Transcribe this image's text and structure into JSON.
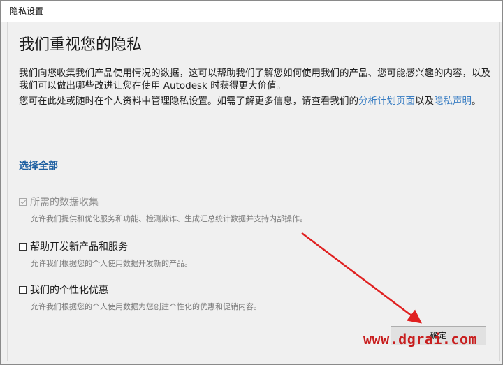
{
  "window": {
    "title": "隐私设置"
  },
  "main": {
    "heading": "我们重视您的隐私",
    "para1": "我们向您收集我们产品使用情况的数据，这可以帮助我们了解您如何使用我们的产品、您可能感兴趣的内容，以及我们可以做出哪些改进让您在使用 Autodesk 时获得更大价值。",
    "para2_prefix": "您可在此处或随时在个人资料中管理隐私设置。如需了解更多信息，请查看我们的",
    "link_analytics": "分析计划页面",
    "para2_mid": "以及",
    "link_privacy": "隐私声明",
    "para2_suffix": "。",
    "select_all": "选择全部",
    "options": [
      {
        "label": "所需的数据收集",
        "desc": "允许我们提供和优化服务和功能、检测欺诈、生成汇总统计数据并支持内部操作。",
        "checked": true,
        "disabled": true
      },
      {
        "label": "帮助开发新产品和服务",
        "desc": "允许我们根据您的个人使用数据开发新的产品。",
        "checked": false,
        "disabled": false
      },
      {
        "label": "我们的个性化优惠",
        "desc": "允许我们根据您的个人使用数据为您创建个性化的优惠和促销内容。",
        "checked": false,
        "disabled": false
      }
    ],
    "confirm_label": "确定"
  },
  "watermark": "www.dgrai.com",
  "colors": {
    "link": "#3a7ec3",
    "select_all": "#1d5fa1",
    "arrow": "#e02020",
    "watermark": "#c81e1e"
  }
}
